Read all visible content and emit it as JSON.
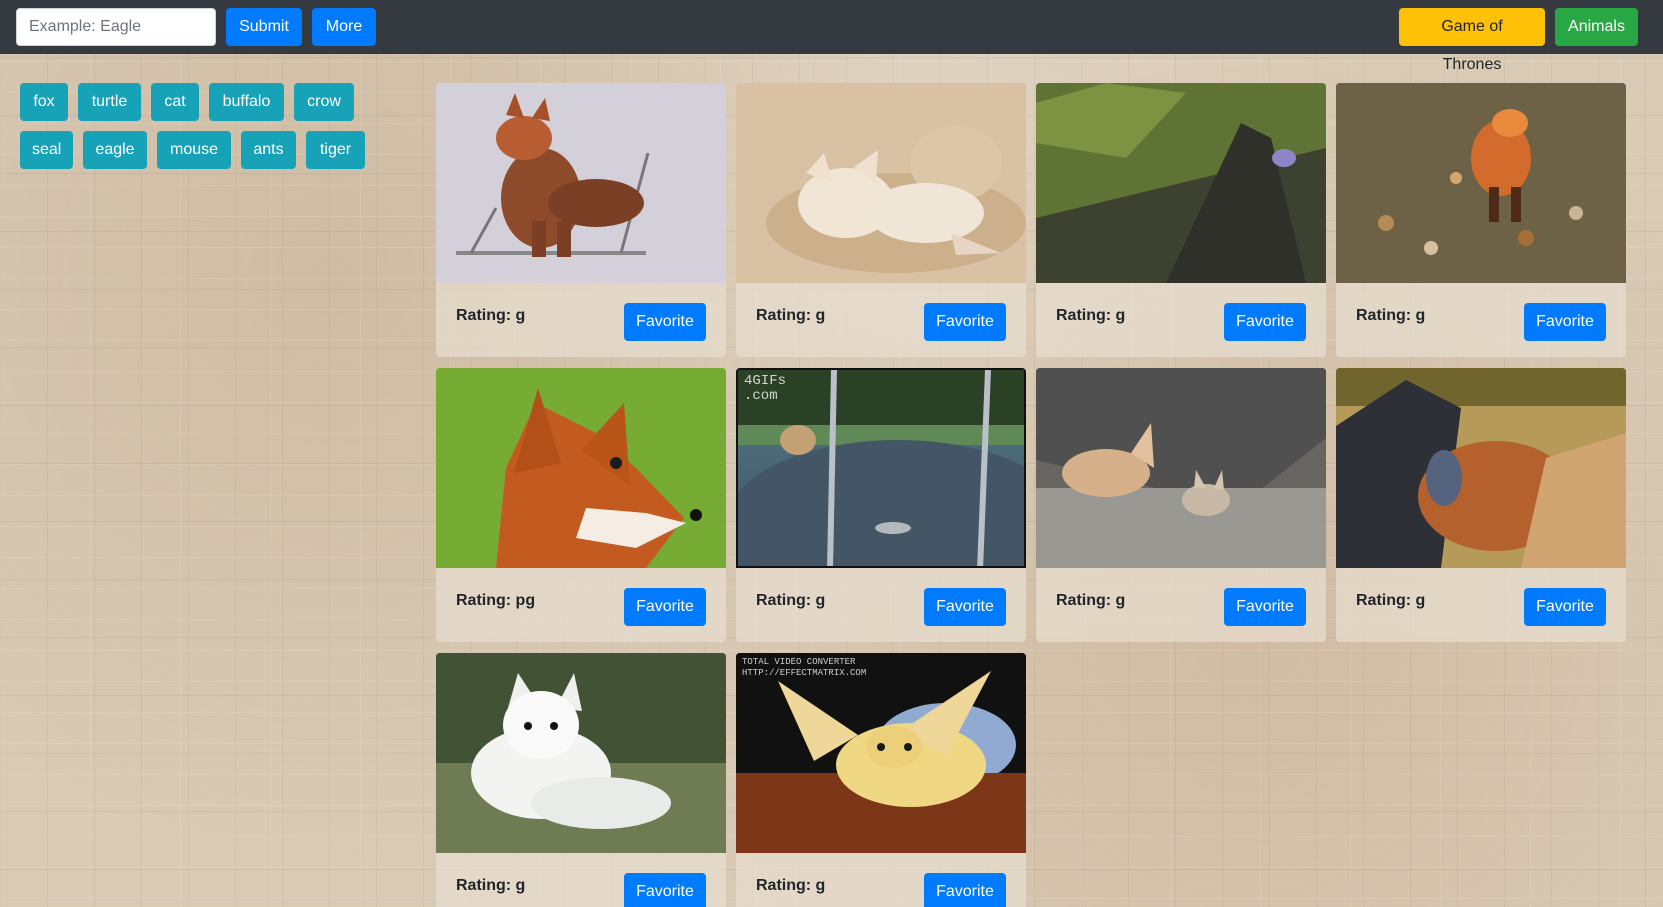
{
  "nav": {
    "search_placeholder": "Example: Eagle",
    "submit_label": "Submit",
    "more_label": "More",
    "category_buttons": [
      "Game of Thrones",
      "Animals"
    ]
  },
  "topics": [
    "fox",
    "turtle",
    "cat",
    "buffalo",
    "crow",
    "seal",
    "eagle",
    "mouse",
    "ants",
    "tiger"
  ],
  "cards": [
    {
      "rating": "Rating: g",
      "favorite_label": "Favorite",
      "scene": "fox sitting on a chair"
    },
    {
      "rating": "Rating: g",
      "favorite_label": "Favorite",
      "scene": "fox and cat sleeping"
    },
    {
      "rating": "Rating: g",
      "favorite_label": "Favorite",
      "scene": "grassy hillside with rocks"
    },
    {
      "rating": "Rating: g",
      "favorite_label": "Favorite",
      "scene": "fox walking on leaves"
    },
    {
      "rating": "Rating: pg",
      "favorite_label": "Favorite",
      "scene": "close-up red fox"
    },
    {
      "rating": "Rating: g",
      "favorite_label": "Favorite",
      "scene": "fox on trampoline",
      "overlay_text": "4GIFs\n.com"
    },
    {
      "rating": "Rating: g",
      "favorite_label": "Favorite",
      "scene": "fennec fox and pup"
    },
    {
      "rating": "Rating: g",
      "favorite_label": "Favorite",
      "scene": "fox with fabric"
    },
    {
      "rating": "Rating: g",
      "favorite_label": "Favorite",
      "scene": "arctic fox lying"
    },
    {
      "rating": "Rating: g",
      "favorite_label": "Favorite",
      "scene": "fennec fox on blanket",
      "overlay_text": "TOTAL VIDEO CONVERTER\nHTTP://EFFECTMATRIX.COM"
    }
  ]
}
